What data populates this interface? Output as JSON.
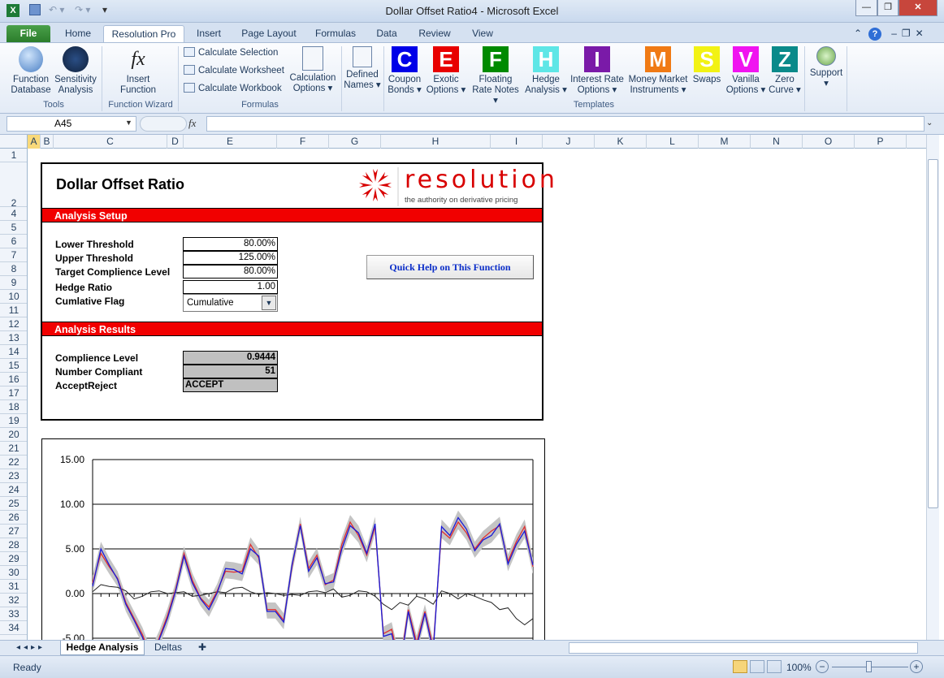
{
  "window": {
    "title": "Dollar Offset Ratio4 - Microsoft Excel"
  },
  "tabs": [
    "File",
    "Home",
    "Resolution Pro",
    "Insert",
    "Page Layout",
    "Formulas",
    "Data",
    "Review",
    "View"
  ],
  "ribbon": {
    "tools": {
      "function_database": "Function Database",
      "sensitivity_analysis": "Sensitivity Analysis",
      "label": "Tools"
    },
    "function_wizard": {
      "insert_function": "Insert Function",
      "label": "Function Wizard"
    },
    "formulas": {
      "calc_selection": "Calculate Selection",
      "calc_worksheet": "Calculate Worksheet",
      "calc_workbook": "Calculate Workbook",
      "calc_options": "Calculation Options",
      "label": "Formulas"
    },
    "defined_names": "Defined Names",
    "templates": {
      "label": "Templates",
      "items": [
        {
          "letter": "C",
          "color": "#0000e8",
          "label": "Coupon Bonds"
        },
        {
          "letter": "E",
          "color": "#e80000",
          "label": "Exotic Options"
        },
        {
          "letter": "F",
          "color": "#008a00",
          "label": "Floating Rate Notes"
        },
        {
          "letter": "H",
          "color": "#5ee6e6",
          "label": "Hedge Analysis"
        },
        {
          "letter": "I",
          "color": "#7a1aa8",
          "label": "Interest Rate Options"
        },
        {
          "letter": "M",
          "color": "#f07a14",
          "label": "Money Market Instruments"
        },
        {
          "letter": "S",
          "color": "#f2f214",
          "label": "Swaps"
        },
        {
          "letter": "V",
          "color": "#f014f0",
          "label": "Vanilla Options"
        },
        {
          "letter": "Z",
          "color": "#0a8a8a",
          "label": "Zero Curve"
        }
      ]
    },
    "support": "Support"
  },
  "formula_bar": {
    "name_box": "A45",
    "fx": "fx",
    "formula": ""
  },
  "columns": [
    "A",
    "B",
    "C",
    "D",
    "E",
    "F",
    "G",
    "H",
    "I",
    "J",
    "K",
    "L",
    "M",
    "N",
    "O",
    "P"
  ],
  "rows": [
    "1",
    "2",
    "4",
    "5",
    "6",
    "7",
    "8",
    "9",
    "10",
    "11",
    "12",
    "13",
    "14",
    "15",
    "16",
    "17",
    "18",
    "19",
    "20",
    "21",
    "22",
    "23",
    "24",
    "25",
    "26",
    "27",
    "28",
    "29",
    "30",
    "31",
    "32",
    "33",
    "34"
  ],
  "report": {
    "title": "Dollar Offset Ratio",
    "logo_text": "resolution",
    "logo_tagline": "the authority on derivative pricing",
    "setup_header": "Analysis Setup",
    "lower_threshold_label": "Lower Threshold",
    "lower_threshold": "80.00%",
    "upper_threshold_label": "Upper Threshold",
    "upper_threshold": "125.00%",
    "target_label": "Target Complience Level",
    "target": "80.00%",
    "hedge_ratio_label": "Hedge Ratio",
    "hedge_ratio": "1.00",
    "cum_flag_label": "Cumlative Flag",
    "cum_flag": "Cumulative",
    "help_button": "Quick Help on This Function",
    "results_header": "Analysis Results",
    "compliance_label": "Complience Level",
    "compliance": "0.9444",
    "num_compliant_label": "Number Compliant",
    "num_compliant": "51",
    "accept_label": "AcceptReject",
    "accept": "ACCEPT"
  },
  "chart_data": {
    "type": "line",
    "ylim": [
      -5,
      15
    ],
    "ytick_labels": [
      "15.00",
      "10.00",
      "5.00",
      "0.00",
      "-5.00"
    ],
    "yticks": [
      15,
      10,
      5,
      0,
      -5
    ],
    "series": [
      {
        "color": "#e03030",
        "values": [
          1.2,
          4.5,
          3.0,
          1.7,
          -1.0,
          -2.8,
          -4.6,
          -7.0,
          -5.0,
          -2.5,
          0.5,
          4.5,
          1.5,
          -0.5,
          -1.5,
          0.3,
          2.5,
          2.4,
          2.5,
          5.5,
          4.0,
          -1.8,
          -1.8,
          -3.0,
          3.0,
          7.8,
          2.8,
          4.3,
          1.0,
          1.5,
          5.5,
          8.0,
          6.5,
          4.3,
          7.5,
          -4.5,
          -4.0,
          -8.0,
          -1.8,
          -5.5,
          -2.0,
          -6.0,
          7.0,
          6.2,
          8.0,
          6.8,
          5.0,
          6.2,
          7.0,
          7.6,
          3.6,
          5.8,
          7.5,
          3.0
        ]
      },
      {
        "color": "#1a1ad8",
        "values": [
          0.8,
          5.0,
          3.2,
          1.6,
          -1.2,
          -3.0,
          -4.9,
          -7.5,
          -5.2,
          -2.8,
          0.3,
          4.2,
          1.2,
          -0.6,
          -1.8,
          0.1,
          2.8,
          2.7,
          2.2,
          5.0,
          4.2,
          -2.0,
          -2.0,
          -3.2,
          3.2,
          7.6,
          2.5,
          4.0,
          1.1,
          1.3,
          5.0,
          7.6,
          6.8,
          4.5,
          7.8,
          -4.8,
          -4.5,
          -8.5,
          -2.0,
          -6.0,
          -2.2,
          -6.5,
          7.5,
          6.5,
          8.5,
          7.2,
          4.8,
          6.0,
          6.5,
          7.8,
          3.3,
          5.5,
          7.0,
          3.2
        ]
      },
      {
        "color": "#222222",
        "values": [
          0.2,
          1.0,
          0.8,
          0.7,
          0.3,
          -0.6,
          -0.3,
          0.2,
          0.3,
          0.0,
          0.1,
          0.2,
          -0.3,
          -0.2,
          0.0,
          0.2,
          0.1,
          0.6,
          0.7,
          0.2,
          -0.1,
          0.1,
          0.0,
          -0.2,
          -0.1,
          -0.2,
          0.2,
          0.3,
          0.1,
          0.5,
          -0.4,
          -0.2,
          0.3,
          0.2,
          -0.3,
          -1.2,
          -1.8,
          -1.0,
          -1.3,
          -0.3,
          -0.6,
          -1.2,
          0.3,
          0.0,
          -0.6,
          0.0,
          -0.3,
          -0.7,
          -1.0,
          -1.8,
          -1.6,
          -2.8,
          -3.5,
          -2.8
        ]
      }
    ]
  },
  "sheets": [
    "Hedge Analysis",
    "Deltas"
  ],
  "status": {
    "ready": "Ready",
    "zoom": "100%"
  }
}
